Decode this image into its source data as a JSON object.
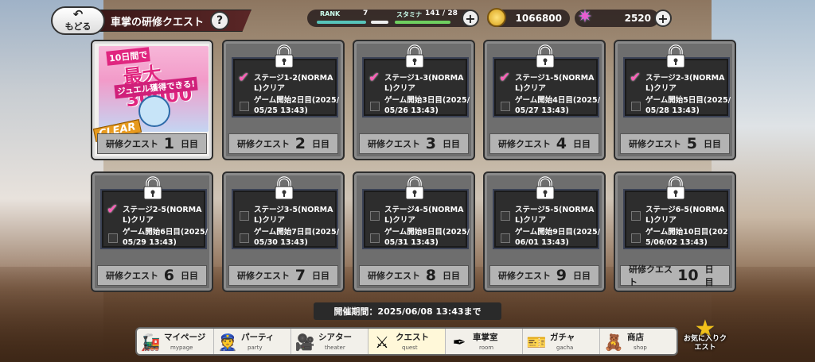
{
  "header": {
    "back_label": "もどる",
    "title": "車掌の研修クエスト",
    "help_label": "?"
  },
  "status": {
    "rank_label": "RANK",
    "rank_value": "7",
    "stamina_label": "スタミナ",
    "stamina_value": "141 / 28",
    "coins": "1066800",
    "gems": "2520",
    "plus": "+"
  },
  "cards": [
    {
      "label": "研修クエスト",
      "num": "1",
      "suffix": "日目",
      "cleared": true,
      "banner": {
        "line1": "10日間で",
        "line2": "最大30000",
        "line3": "ジュエル獲得できる!",
        "clear": "CLEAR"
      }
    },
    {
      "label": "研修クエスト",
      "num": "2",
      "suffix": "日目",
      "cond1": "ステージ1-2(NORMAL)クリア",
      "cond2": "ゲーム開始2日目(2025/05/25 13:43)",
      "check1": true,
      "check2": false
    },
    {
      "label": "研修クエスト",
      "num": "3",
      "suffix": "日目",
      "cond1": "ステージ1-3(NORMAL)クリア",
      "cond2": "ゲーム開始3日目(2025/05/26 13:43)",
      "check1": true,
      "check2": false
    },
    {
      "label": "研修クエスト",
      "num": "4",
      "suffix": "日目",
      "cond1": "ステージ1-5(NORMAL)クリア",
      "cond2": "ゲーム開始4日目(2025/05/27 13:43)",
      "check1": true,
      "check2": false
    },
    {
      "label": "研修クエスト",
      "num": "5",
      "suffix": "日目",
      "cond1": "ステージ2-3(NORMAL)クリア",
      "cond2": "ゲーム開始5日目(2025/05/28 13:43)",
      "check1": true,
      "check2": false
    },
    {
      "label": "研修クエスト",
      "num": "6",
      "suffix": "日目",
      "cond1": "ステージ2-5(NORMAL)クリア",
      "cond2": "ゲーム開始6日目(2025/05/29 13:43)",
      "check1": true,
      "check2": false
    },
    {
      "label": "研修クエスト",
      "num": "7",
      "suffix": "日目",
      "cond1": "ステージ3-5(NORMAL)クリア",
      "cond2": "ゲーム開始7日目(2025/05/30 13:43)",
      "check1": false,
      "check2": false
    },
    {
      "label": "研修クエスト",
      "num": "8",
      "suffix": "日目",
      "cond1": "ステージ4-5(NORMAL)クリア",
      "cond2": "ゲーム開始8日目(2025/05/31 13:43)",
      "check1": false,
      "check2": false
    },
    {
      "label": "研修クエスト",
      "num": "9",
      "suffix": "日目",
      "cond1": "ステージ5-5(NORMAL)クリア",
      "cond2": "ゲーム開始9日目(2025/06/01 13:43)",
      "check1": false,
      "check2": false
    },
    {
      "label": "研修クエスト",
      "num": "10",
      "suffix": "日目",
      "cond1": "ステージ6-5(NORMAL)クリア",
      "cond2": "ゲーム開始10日目(2025/06/02 13:43)",
      "check1": false,
      "check2": false
    }
  ],
  "period": "開催期間：2025/06/08 13:43まで",
  "nav": [
    {
      "jp": "マイページ",
      "en": "mypage",
      "icon": "train-icon",
      "glyph": "🚂"
    },
    {
      "jp": "パーティ",
      "en": "party",
      "icon": "conductor-icon",
      "glyph": "👮"
    },
    {
      "jp": "シアター",
      "en": "theater",
      "icon": "camera-icon",
      "glyph": "🎥"
    },
    {
      "jp": "クエスト",
      "en": "quest",
      "icon": "crossed-tools-icon",
      "glyph": "⚔"
    },
    {
      "jp": "車掌室",
      "en": "room",
      "icon": "pen-icon",
      "glyph": "✒"
    },
    {
      "jp": "ガチャ",
      "en": "gacha",
      "icon": "ticket-icon",
      "glyph": "🎫"
    },
    {
      "jp": "商店",
      "en": "shop",
      "icon": "bear-icon",
      "glyph": "🧸"
    }
  ],
  "favorite": {
    "label": "お気に入りクエスト",
    "glyph": "★"
  }
}
